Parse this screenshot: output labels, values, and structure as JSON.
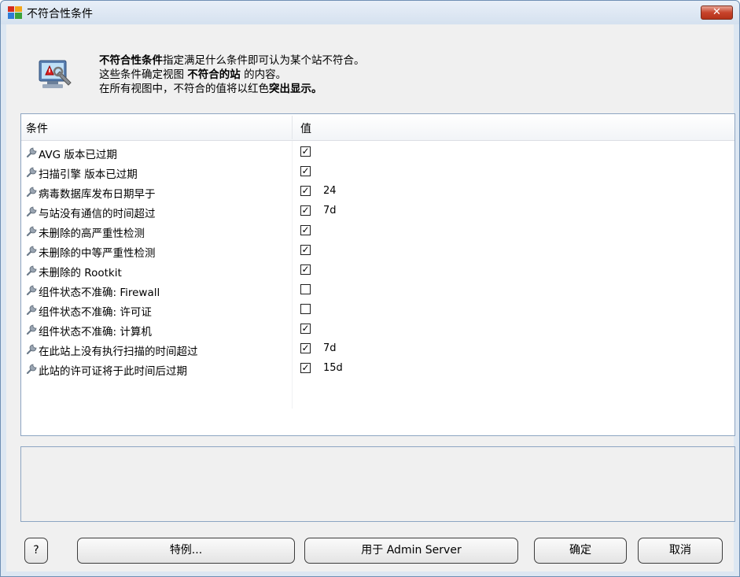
{
  "window": {
    "title": "不符合性条件",
    "close_glyph": "✕"
  },
  "description": {
    "line1_bold": "不符合性条件",
    "line1_rest": "指定满足什么条件即可认为某个站不符合。",
    "line2_pre": "这些条件确定视图 ",
    "line2_bold": "不符合的站",
    "line2_post": " 的内容。",
    "line3_pre": "在所有视图中，不符合的值将以红色",
    "line3_bold": "突出显示。"
  },
  "table": {
    "columns": [
      "条件",
      "值"
    ],
    "rows": [
      {
        "label": "AVG 版本已过期",
        "checked": true,
        "value": ""
      },
      {
        "label": "扫描引擎 版本已过期",
        "checked": true,
        "value": ""
      },
      {
        "label": "病毒数据库发布日期早于",
        "checked": true,
        "value": "24"
      },
      {
        "label": "与站没有通信的时间超过",
        "checked": true,
        "value": "7d"
      },
      {
        "label": "未删除的高严重性检测",
        "checked": true,
        "value": ""
      },
      {
        "label": "未删除的中等严重性检测",
        "checked": true,
        "value": ""
      },
      {
        "label": "未删除的 Rootkit",
        "checked": true,
        "value": ""
      },
      {
        "label": "组件状态不准确: Firewall",
        "checked": false,
        "value": ""
      },
      {
        "label": "组件状态不准确: 许可证",
        "checked": false,
        "value": ""
      },
      {
        "label": "组件状态不准确: 计算机",
        "checked": true,
        "value": ""
      },
      {
        "label": "在此站上没有执行扫描的时间超过",
        "checked": true,
        "value": "7d"
      },
      {
        "label": "此站的许可证将于此时间后过期",
        "checked": true,
        "value": "15d"
      }
    ],
    "row_icon": "wrench-icon"
  },
  "buttons": {
    "help": "?",
    "exceptions": "特例...",
    "apply_admin": "用于 Admin Server",
    "ok": "确定",
    "cancel": "取消"
  },
  "colors": {
    "title_bg": "#dde7f2",
    "close_red": "#c7432b",
    "border": "#8da5c2"
  }
}
